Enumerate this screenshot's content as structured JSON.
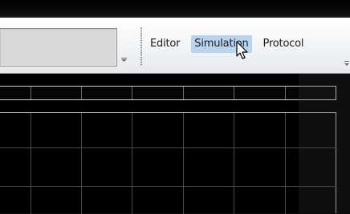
{
  "toolbar": {
    "combo_value": "",
    "menu": [
      {
        "label": "Editor"
      },
      {
        "label": "Simulation",
        "hovered": true
      },
      {
        "label": "Protocol"
      }
    ]
  },
  "colors": {
    "menu_hover": "#b8d4ef",
    "panel_background": "#000000",
    "grid_line": "#4a4a4a"
  },
  "icons": {
    "combo_dropdown": "chevron-down-icon",
    "toolbar_grip": "grip-icon",
    "overflow": "chevron-down-icon",
    "cursor": "hand-pointer-icon"
  }
}
